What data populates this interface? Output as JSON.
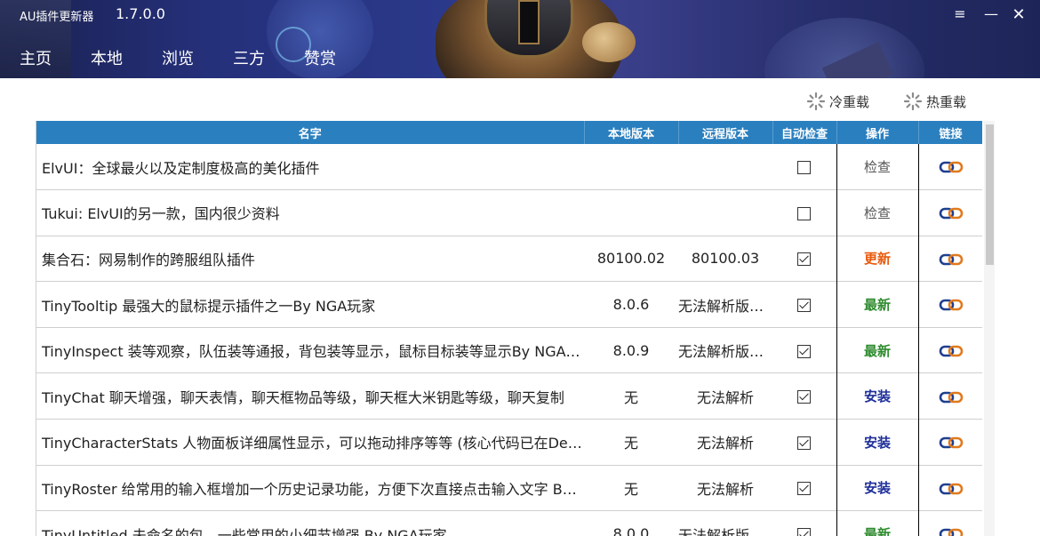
{
  "app": {
    "title": "AU插件更新器",
    "version": "1.7.0.0",
    "window_controls": {
      "menu_icon": "≡",
      "minimize_icon": "—",
      "close_icon": "✕"
    }
  },
  "nav": {
    "items": [
      {
        "label": "主页"
      },
      {
        "label": "本地"
      },
      {
        "label": "浏览"
      },
      {
        "label": "三方"
      },
      {
        "label": "赞赏"
      }
    ]
  },
  "toolbar": {
    "cold_reload_label": "冷重载",
    "hot_reload_label": "热重载",
    "icon": "spinner-icon"
  },
  "table": {
    "header_color": "#2a7fbf",
    "columns": {
      "name": "名字",
      "local_version": "本地版本",
      "remote_version": "远程版本",
      "auto_check": "自动检查",
      "action": "操作",
      "link": "链接"
    },
    "rows": [
      {
        "name": "ElvUI：全球最火以及定制度极高的美化插件",
        "local_version": "",
        "remote_version": "",
        "auto_check": false,
        "action": "检查",
        "action_type": "check"
      },
      {
        "name": "Tukui: ElvUI的另一款，国内很少资料",
        "local_version": "",
        "remote_version": "",
        "auto_check": false,
        "action": "检查",
        "action_type": "check"
      },
      {
        "name": "集合石：网易制作的跨服组队插件",
        "local_version": "80100.02",
        "remote_version": "80100.03",
        "auto_check": true,
        "action": "更新",
        "action_type": "update"
      },
      {
        "name": "TinyTooltip 最强大的鼠标提示插件之一By NGA玩家",
        "local_version": "8.0.6",
        "remote_version": "无法解析版本号",
        "auto_check": true,
        "action": "最新",
        "action_type": "latest"
      },
      {
        "name": "TinyInspect 装等观察，队伍装等通报，背包装等显示，鼠标目标装等显示By NGA玩家",
        "local_version": "8.0.9",
        "remote_version": "无法解析版本号",
        "auto_check": true,
        "action": "最新",
        "action_type": "latest"
      },
      {
        "name": "TinyChat 聊天增强，聊天表情，聊天框物品等级，聊天框大米钥匙等级，聊天复制",
        "local_version": "无",
        "remote_version": "无法解析",
        "auto_check": true,
        "action": "安装",
        "action_type": "install"
      },
      {
        "name": "TinyCharacterStats 人物面板详细属性显示，可以拖动排序等等 (核心代码已在DejaCharacterStats",
        "local_version": "无",
        "remote_version": "无法解析",
        "auto_check": true,
        "action": "安装",
        "action_type": "install"
      },
      {
        "name": "TinyRoster 给常用的输入框增加一个历史记录功能，方便下次直接点击输入文字 By NGA玩家",
        "local_version": "无",
        "remote_version": "无法解析",
        "auto_check": true,
        "action": "安装",
        "action_type": "install"
      },
      {
        "name": "TinyUntitled 未命名的包，一些常用的小细节增强 By NGA玩家",
        "local_version": "8.0.0",
        "remote_version": "无法解析版本号",
        "auto_check": true,
        "action": "最新",
        "action_type": "latest"
      }
    ]
  },
  "colors": {
    "update": "#e8590c",
    "latest": "#2e8b2e",
    "install": "#1f2f9a",
    "check": "#555555",
    "link_icon_orange": "#e07a1f",
    "link_icon_blue": "#1f3f8f"
  }
}
